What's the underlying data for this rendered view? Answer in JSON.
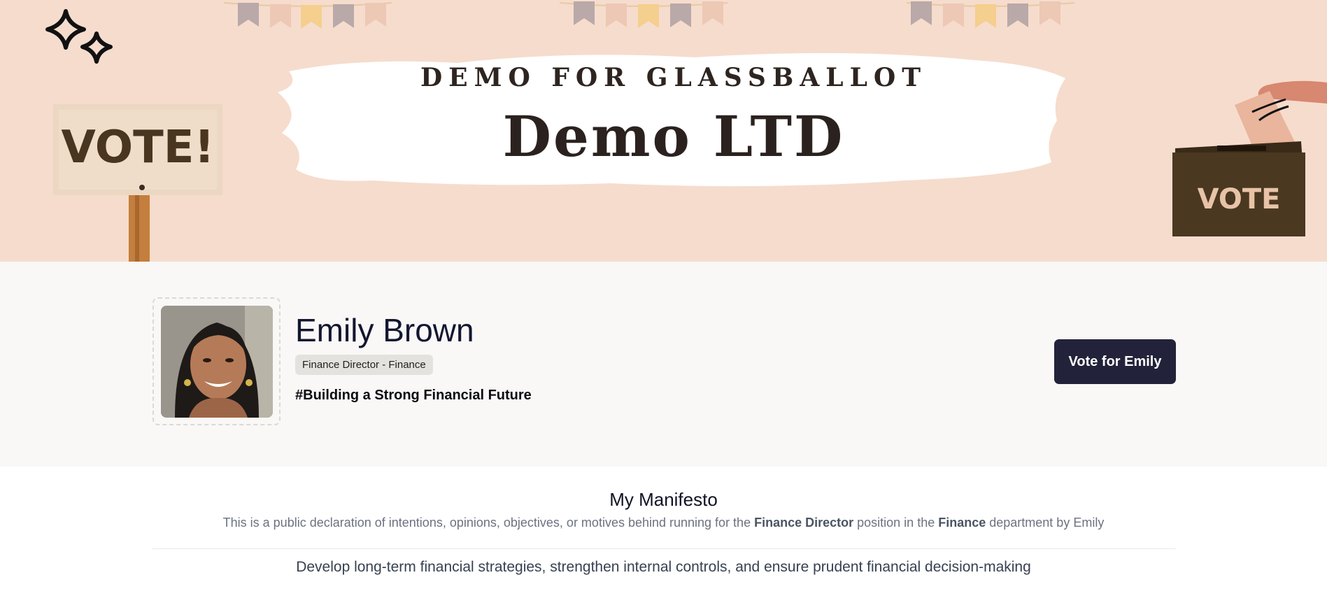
{
  "banner": {
    "subtitle": "DEMO FOR GLASSBALLOT",
    "title": "Demo LTD",
    "vote_sign_text": "VOTE!",
    "ballot_box_text": "VOTE"
  },
  "candidate": {
    "name": "Emily Brown",
    "role_badge": "Finance Director - Finance",
    "slogan": "#Building a Strong Financial Future",
    "vote_button_label": "Vote for Emily"
  },
  "manifesto": {
    "heading": "My Manifesto",
    "desc_prefix": "This is a public declaration of intentions, opinions, objectives, or motives behind running for the ",
    "desc_position": "Finance Director",
    "desc_middle": " position in the ",
    "desc_department": "Finance",
    "desc_suffix": " department by Emily",
    "statement": "Develop long-term financial strategies, strengthen internal controls, and ensure prudent financial decision-making"
  },
  "colors": {
    "banner_bg": "#f6dccd",
    "button_bg": "#22223a",
    "profile_bg": "#f9f8f6"
  }
}
